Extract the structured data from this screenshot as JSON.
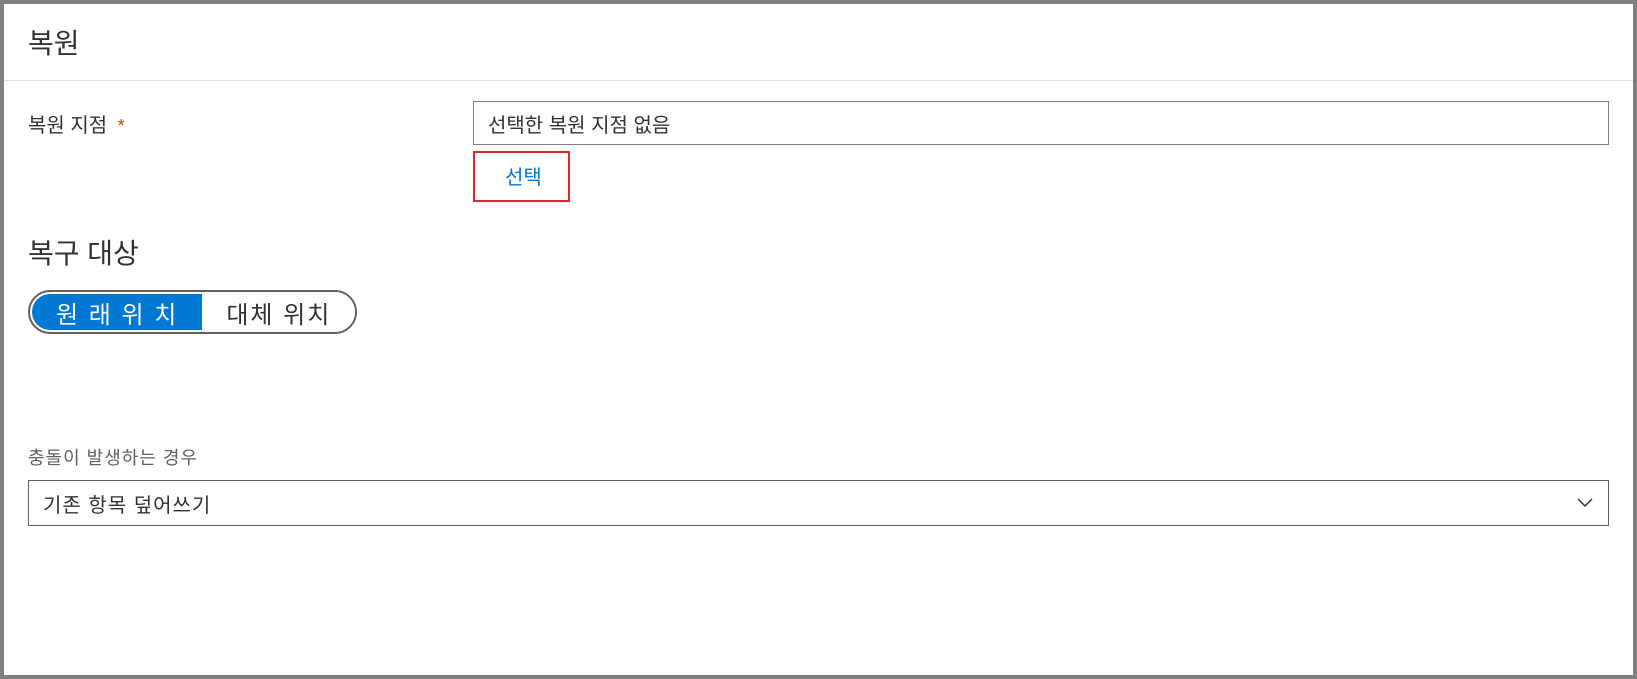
{
  "page": {
    "title": "복원"
  },
  "restorePoint": {
    "label": "복원 지점",
    "value": "선택한 복원 지점 없음",
    "selectLink": "선택"
  },
  "recoveryTarget": {
    "title": "복구 대상",
    "options": {
      "original": "원 래 위 치",
      "alternate": "대체 위치"
    }
  },
  "conflict": {
    "label": "충돌이 발생하는 경우",
    "selected": "기존 항목 덮어쓰기"
  }
}
